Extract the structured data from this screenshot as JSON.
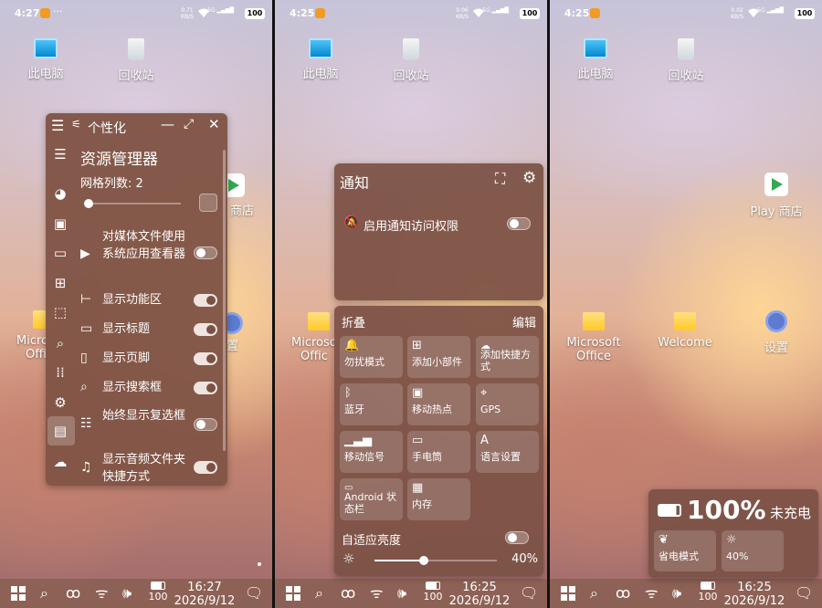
{
  "screens": [
    {
      "status": {
        "time": "4:27",
        "speed_top": "0.71",
        "speed_unit": "KB/S",
        "net": "5G",
        "battery": "100"
      },
      "desktop": {
        "this_pc": "此电脑",
        "recycle_bin": "回收站",
        "play_store_partial": "商店",
        "folder_partial": "Micro",
        "folder_partial2": "Offi",
        "settings_partial": "置"
      },
      "taskbar": {
        "battery": "100",
        "time": "16:27",
        "date": "2026/9/12"
      },
      "personalize": {
        "title": "个性化",
        "section_title": "资源管理器",
        "grid_columns": "网格列数: 2",
        "grid_columns_value": 2,
        "rows": [
          {
            "label": "对媒体文件使用系统应用查看器",
            "icon": "play-square-icon",
            "on": false
          },
          {
            "label": "显示功能区",
            "icon": "ribbon-icon",
            "on": true
          },
          {
            "label": "显示标题",
            "icon": "title-icon",
            "on": true
          },
          {
            "label": "显示页脚",
            "icon": "footer-icon",
            "on": true
          },
          {
            "label": "显示搜索框",
            "icon": "search-icon",
            "on": true
          },
          {
            "label": "始终显示复选框",
            "icon": "checklist-icon",
            "on": false
          },
          {
            "label": "显示音频文件夹快捷方式",
            "icon": "music-icon",
            "on": true
          }
        ]
      }
    },
    {
      "status": {
        "time": "4:25",
        "speed_top": "0.06",
        "speed_unit": "KB/S",
        "net": "5G",
        "battery": "100"
      },
      "desktop": {
        "this_pc": "此电脑",
        "recycle_bin": "回收站",
        "folder_partial": "Microso",
        "folder_partial2": "Offic"
      },
      "taskbar": {
        "battery": "100",
        "time": "16:25",
        "date": "2026/9/12"
      },
      "notifications": {
        "title": "通知",
        "access_label": "启用通知访问权限",
        "access_on": false
      },
      "control": {
        "title": "折叠",
        "edit": "编辑",
        "tiles": [
          {
            "label": "勿扰模式",
            "icon": "bell-icon"
          },
          {
            "label": "添加小部件",
            "icon": "widgets-icon"
          },
          {
            "label": "添加快捷方式",
            "icon": "shortcut-icon"
          },
          {
            "label": "蓝牙",
            "icon": "bluetooth-icon"
          },
          {
            "label": "移动热点",
            "icon": "hotspot-icon"
          },
          {
            "label": "GPS",
            "icon": "location-icon"
          },
          {
            "label": "移动信号",
            "icon": "signal-icon"
          },
          {
            "label": "手电筒",
            "icon": "flashlight-icon"
          },
          {
            "label": "语言设置",
            "icon": "language-icon"
          },
          {
            "label": "Android 状态栏",
            "icon": "statusbar-icon"
          },
          {
            "label": "内存",
            "icon": "memory-icon"
          }
        ],
        "auto_brightness": "自适应亮度",
        "auto_brightness_on": false,
        "brightness_text": "40%",
        "brightness_value": 0.4
      }
    },
    {
      "status": {
        "time": "4:25",
        "speed_top": "0.02",
        "speed_unit": "KB/S",
        "net": "5G",
        "battery": "100"
      },
      "desktop": {
        "this_pc": "此电脑",
        "recycle_bin": "回收站",
        "play_store": "Play 商店",
        "folder1": "Microsoft",
        "folder1b": "Office",
        "folder2": "Welcome",
        "settings": "设置"
      },
      "taskbar": {
        "battery": "100",
        "time": "16:25",
        "date": "2026/9/12"
      },
      "battery_panel": {
        "percent": "100%",
        "state": "未充电",
        "power_saver": "省电模式",
        "brightness": "40%"
      }
    }
  ]
}
